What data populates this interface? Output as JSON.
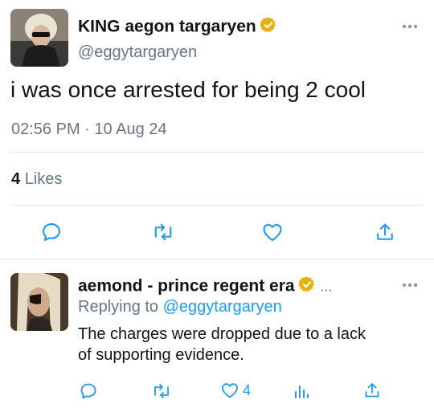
{
  "tweet": {
    "display_name": "KING aegon targaryen",
    "handle": "@eggytargaryen",
    "text": "i was once arrested for being 2 cool",
    "time": "02:56 PM",
    "separator": "·",
    "date": "10 Aug 24",
    "likes_count": "4",
    "likes_label": "Likes",
    "more_icon": "more-dots-icon",
    "verified_color": "#e8b00f"
  },
  "reply": {
    "display_name": "aemond - prince regent era",
    "ellipsis": "...",
    "replying_prefix": "Replying to",
    "replying_handle": "@eggytargaryen",
    "text_line1": "The charges were dropped due to a lack",
    "text_line2": "of supporting evidence.",
    "like_count": "4"
  },
  "colors": {
    "accent": "#1d9bf0",
    "muted": "#687684",
    "divider": "#e1e8ed"
  }
}
